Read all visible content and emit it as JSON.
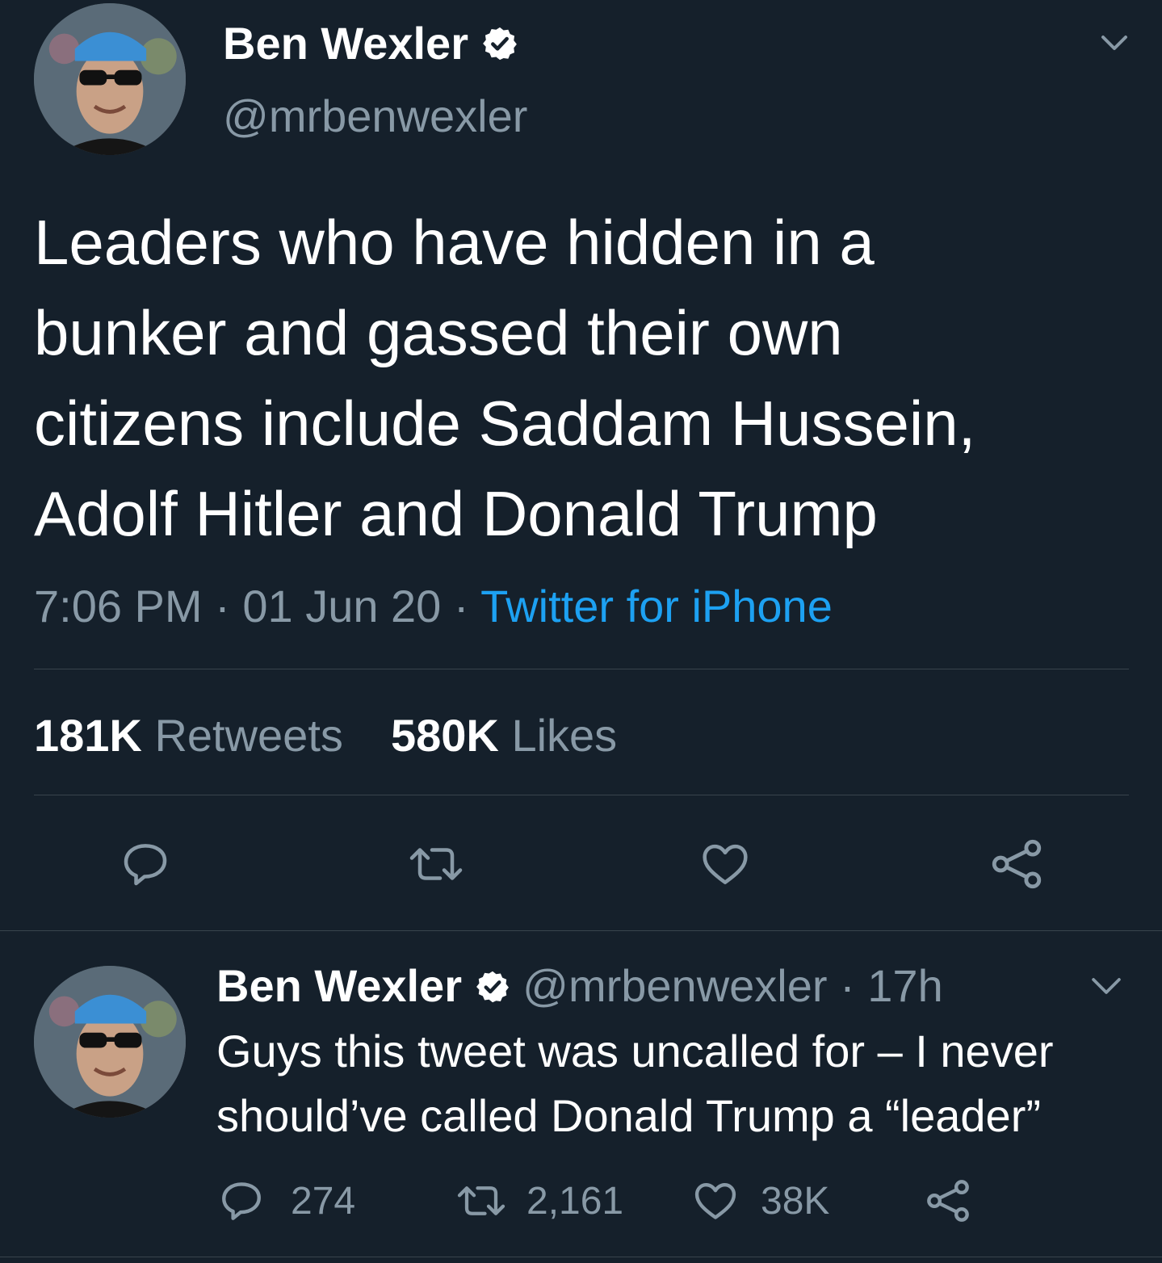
{
  "tweet": {
    "author_name": "Ben Wexler",
    "author_handle": "@mrbenwexler",
    "text_lines": [
      "Leaders who have hidden in a",
      "bunker and gassed their own",
      "citizens include Saddam Hussein,",
      "Adolf Hitler and Donald Trump"
    ],
    "time": "7:06 PM",
    "sep1": "·",
    "date": "01 Jun 20",
    "sep2": "·",
    "source": "Twitter for iPhone",
    "retweets_count": "181K",
    "retweets_label": "Retweets",
    "likes_count": "580K",
    "likes_label": "Likes"
  },
  "reply": {
    "author_name": "Ben Wexler",
    "author_handle": "@mrbenwexler",
    "age": "· 17h",
    "text_lines": [
      "Guys this tweet was uncalled for – I never",
      "should’ve called Donald Trump a “leader”"
    ],
    "reply_count": "274",
    "retweet_count": "2,161",
    "like_count": "38K"
  },
  "colors": {
    "background": "#15202b",
    "text": "#ffffff",
    "muted": "#8899a6",
    "link": "#1da1f2",
    "divider": "#38444d"
  },
  "icons": [
    "chevron-down-icon",
    "verified-icon",
    "reply-icon",
    "retweet-icon",
    "like-icon",
    "share-icon"
  ]
}
